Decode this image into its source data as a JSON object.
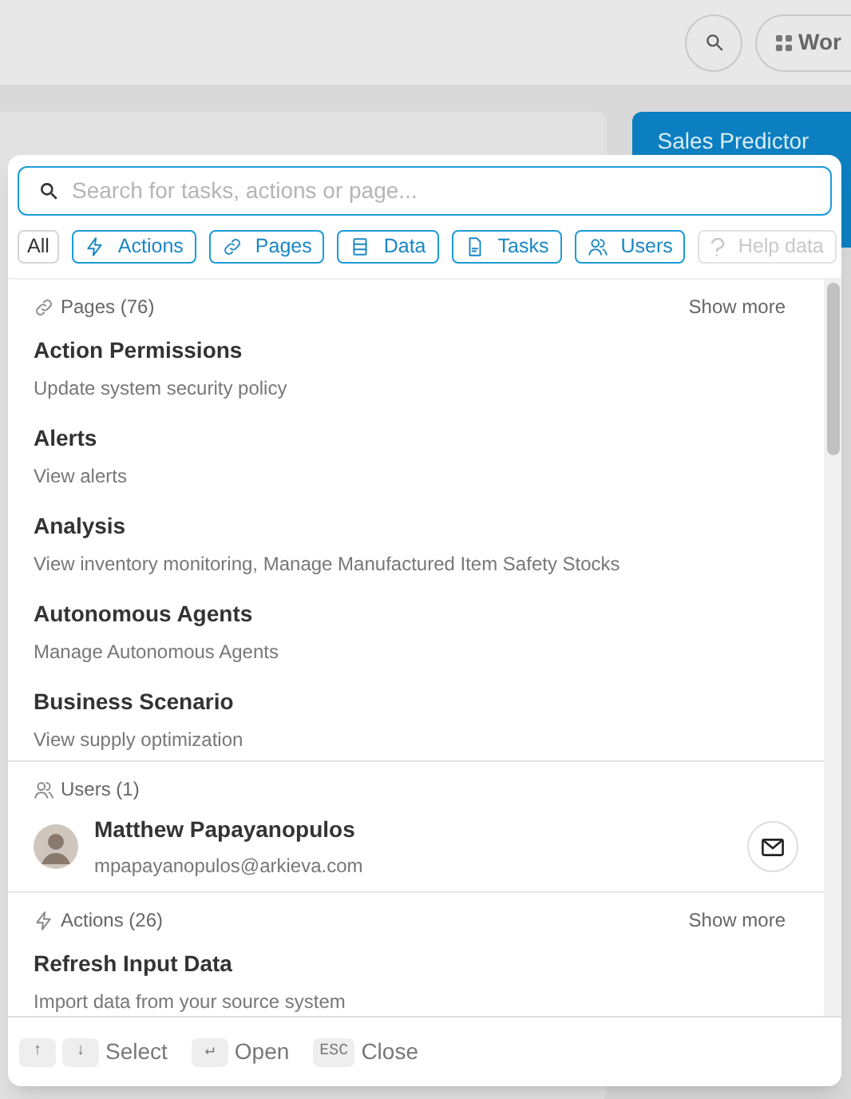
{
  "top_bar": {
    "workspace_button": "Wor"
  },
  "background": {
    "promo_card_title": "Sales Predictor"
  },
  "search_dialog": {
    "search": {
      "placeholder": "Search for tasks, actions or page..."
    },
    "filters": [
      {
        "label": "All",
        "kind": "all",
        "selected": false
      },
      {
        "label": "Actions",
        "kind": "actions",
        "selected": true
      },
      {
        "label": "Pages",
        "kind": "pages",
        "selected": true
      },
      {
        "label": "Data",
        "kind": "data",
        "selected": true
      },
      {
        "label": "Tasks",
        "kind": "tasks",
        "selected": true
      },
      {
        "label": "Users",
        "kind": "users",
        "selected": true
      }
    ],
    "help_button": {
      "label": "Help data",
      "disabled": true
    },
    "sections": [
      {
        "kind": "pages",
        "title": "Pages (76)",
        "show_more": "Show more",
        "items": [
          {
            "title": "Action Permissions",
            "subtitle": "Update system security policy"
          },
          {
            "title": "Alerts",
            "subtitle": "View alerts"
          },
          {
            "title": "Analysis",
            "subtitle": "View inventory monitoring, Manage Manufactured Item Safety Stocks"
          },
          {
            "title": "Autonomous Agents",
            "subtitle": "Manage Autonomous Agents"
          },
          {
            "title": "Business Scenario",
            "subtitle": "View supply optimization"
          }
        ]
      },
      {
        "kind": "users",
        "title": "Users (1)",
        "items": [
          {
            "title": "Matthew Papayanopulos",
            "subtitle": "mpapayanopulos@arkieva.com"
          }
        ]
      },
      {
        "kind": "actions",
        "title": "Actions (26)",
        "show_more": "Show more",
        "items": [
          {
            "title": "Refresh Input Data",
            "subtitle": "Import data from your source system"
          }
        ]
      }
    ],
    "footer": [
      {
        "keys": [
          "↑",
          "↓"
        ],
        "label": "Select"
      },
      {
        "keys": [
          "↵"
        ],
        "label": "Open"
      },
      {
        "keys": [
          "ESC"
        ],
        "label": "Close"
      }
    ]
  }
}
